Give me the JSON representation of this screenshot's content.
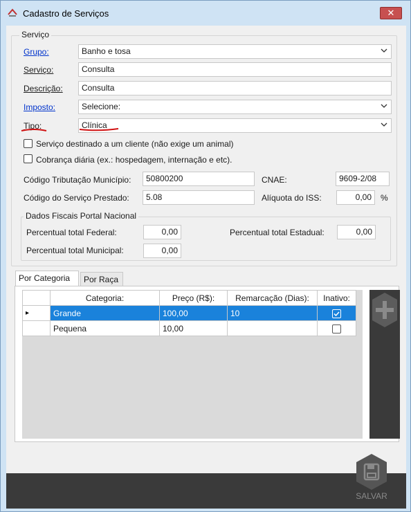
{
  "window": {
    "title": "Cadastro de Serviços",
    "close_symbol": "✕"
  },
  "servico_group": {
    "title": "Serviço",
    "grupo_label": "Grupo:",
    "grupo_value": "Banho e tosa",
    "servico_label": "Serviço:",
    "servico_value": "Consulta",
    "descricao_label": "Descrição:",
    "descricao_value": "Consulta",
    "imposto_label": "Imposto:",
    "imposto_value": "Selecione:",
    "tipo_label": "Tipo:",
    "tipo_value": "Clínica",
    "check_cliente_label": "Serviço destinado a um cliente (não exige um animal)",
    "check_cliente_checked": false,
    "check_diaria_label": "Cobrança diária (ex.: hospedagem, internação e etc).",
    "check_diaria_checked": false,
    "cod_trib_label": "Código Tributação Município:",
    "cod_trib_value": "50800200",
    "cnae_label": "CNAE:",
    "cnae_value": "9609-2/08",
    "cod_serv_label": "Código do Serviço Prestado:",
    "cod_serv_value": "5.08",
    "aliquota_label": "Alíquota do ISS:",
    "aliquota_value": "0,00",
    "aliquota_unit": "%"
  },
  "fiscal_group": {
    "title": "Dados Fiscais Portal Nacional",
    "federal_label": "Percentual total Federal:",
    "federal_value": "0,00",
    "estadual_label": "Percentual total Estadual:",
    "estadual_value": "0,00",
    "municipal_label": "Percentual total Municipal:",
    "municipal_value": "0,00"
  },
  "tabs": [
    {
      "label": "Por Categoria",
      "active": true
    },
    {
      "label": "Por Raça",
      "active": false
    }
  ],
  "grid": {
    "columns": [
      "Categoria:",
      "Preço (R$):",
      "Remarcação (Dias):",
      "Inativo:"
    ],
    "rows": [
      {
        "categoria": "Grande",
        "preco": "100,00",
        "remarcacao": "10",
        "inativo": true,
        "selected": true,
        "row_marker": "▸"
      },
      {
        "categoria": "Pequena",
        "preco": "10,00",
        "remarcacao": "",
        "inativo": false,
        "selected": false,
        "row_marker": ""
      }
    ]
  },
  "actions": {
    "add_icon": "plus-icon",
    "save_label": "SALVAR"
  },
  "colors": {
    "selection": "#1a82db",
    "dark_panel": "#3a3a3a",
    "link": "#0033cc",
    "annotation": "#d01010"
  }
}
